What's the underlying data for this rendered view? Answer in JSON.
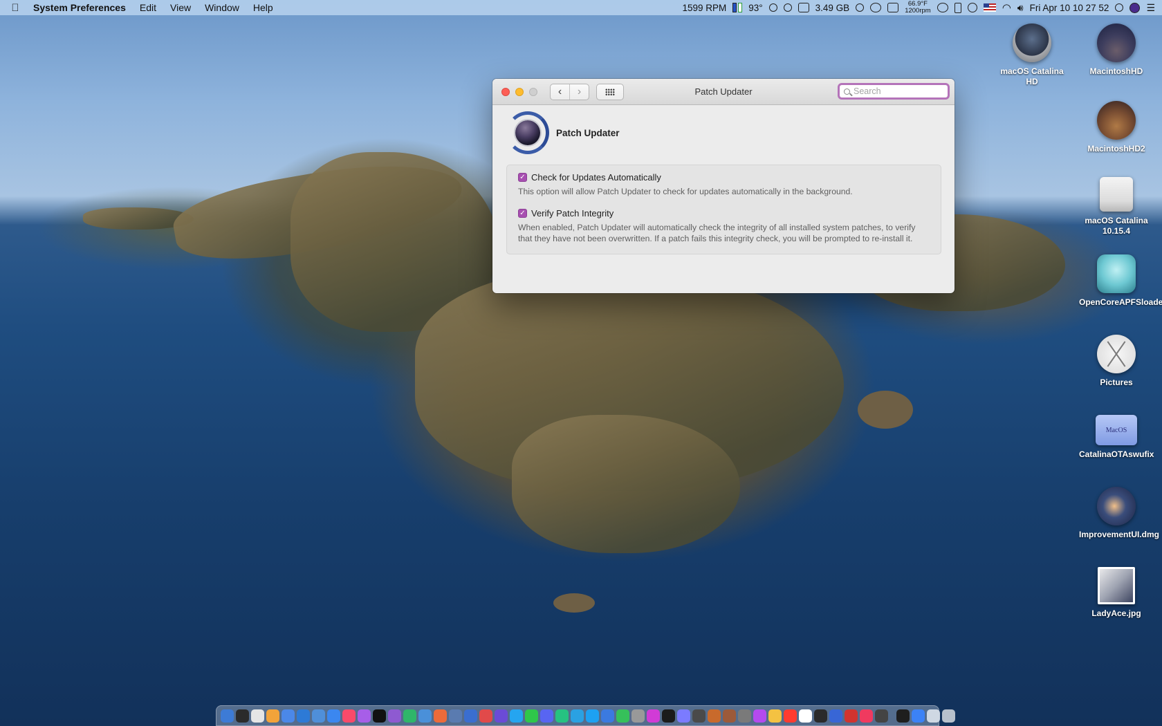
{
  "menubar": {
    "apple_icon": "apple-logo-icon",
    "app_name": "System Preferences",
    "menus": [
      "Edit",
      "View",
      "Window",
      "Help"
    ],
    "fan_rpm": "1599 RPM",
    "cpu_temp": "93°",
    "memory": "3.49 GB",
    "weather_temp": "66.9°F",
    "weather_rpm": "1200rpm",
    "datetime": "Fri Apr 10  10 27 52"
  },
  "window": {
    "title": "Patch Updater",
    "search_placeholder": "Search",
    "pane_title": "Patch Updater",
    "options": [
      {
        "label": "Check for Updates Automatically",
        "checked": true,
        "description": "This option will allow Patch Updater to check for updates automatically in the background."
      },
      {
        "label": "Verify Patch Integrity",
        "checked": true,
        "description": "When enabled, Patch Updater will automatically check the integrity of all installed system patches, to verify that they have not been overwritten. If a patch fails this integrity check, you will be prompted to re-install it."
      }
    ]
  },
  "desktop_icons": [
    {
      "label": "macOS Catalina HD",
      "icon": "disk-icon"
    },
    {
      "label": "MacintoshHD",
      "icon": "catalina-disk-icon"
    },
    {
      "label": "MacintoshHD2",
      "icon": "mojave-disk-icon"
    },
    {
      "label": "macOS Catalina 10.15.4",
      "icon": "external-drive-icon"
    },
    {
      "label": "OpenCoreAPFSloader",
      "icon": "opencore-icon"
    },
    {
      "label": "Pictures",
      "icon": "osx-x-icon"
    },
    {
      "label": "CatalinaOTAswufix",
      "icon": "folder-icon"
    },
    {
      "label": "ImprovementUI.dmg",
      "icon": "dmg-icon"
    },
    {
      "label": "LadyAce.jpg",
      "icon": "photo-icon"
    }
  ],
  "folder_badge_text": "MacOS",
  "accent_color": "#a74fb0",
  "dock_colors": [
    "#3d7bd6",
    "#2b2b2b",
    "#e5e5e5",
    "#f2a33a",
    "#4b88e8",
    "#2d7ad6",
    "#4f8fd9",
    "#3b87f0",
    "#f94a6a",
    "#a75ee8",
    "#111111",
    "#8e5ad1",
    "#2fb66a",
    "#4a90d9",
    "#ec6b3a",
    "#5a7bb0",
    "#3a6ed0",
    "#e14a4a",
    "#6b4bd6",
    "#25a5f0",
    "#2fc74a",
    "#5865f2",
    "#26c281",
    "#2aa1e2",
    "#1da1f2",
    "#3b7ae0",
    "#36c05a",
    "#999999",
    "#d13bd6",
    "#1b1b1b",
    "#7b7bff",
    "#4a4a4a",
    "#c86a2c",
    "#9c5a3a",
    "#7a7a7a",
    "#b44aef",
    "#f4c242",
    "#ff3b30",
    "#ffffff",
    "#2a2a2a",
    "#3866d6",
    "#d1342f",
    "#f03a5f",
    "#444444",
    "#1e1e1e",
    "#3c82f6",
    "#cfd8e3",
    "#b8c1cc"
  ]
}
